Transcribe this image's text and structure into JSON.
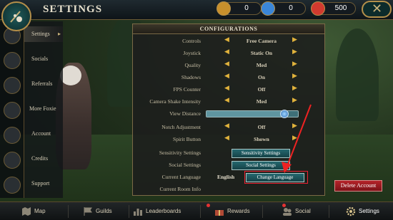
{
  "header": {
    "title": "SETTINGS"
  },
  "resources": [
    {
      "icon": "compass-coin-icon",
      "value": "0",
      "color": "#c8902c"
    },
    {
      "icon": "blue-orb-icon",
      "value": "0",
      "color": "#3a86d8"
    },
    {
      "icon": "red-gem-icon",
      "value": "500",
      "color": "#d13a2f"
    }
  ],
  "menu": {
    "items": [
      {
        "label": "Settings",
        "active": true
      },
      {
        "label": "Socials"
      },
      {
        "label": "Referrals"
      },
      {
        "label": "More Foxie"
      },
      {
        "label": "Account"
      },
      {
        "label": "Credits"
      },
      {
        "label": "Support"
      }
    ]
  },
  "config": {
    "title": "CONFIGURATIONS",
    "rows": [
      {
        "label": "Controls",
        "value": "Free Camera"
      },
      {
        "label": "Joystick",
        "value": "Static On"
      },
      {
        "label": "Quality",
        "value": "Med"
      },
      {
        "label": "Shadows",
        "value": "On"
      },
      {
        "label": "FPS Counter",
        "value": "Off"
      },
      {
        "label": "Camera Shake Intensity",
        "value": "Med"
      }
    ],
    "view_distance": {
      "label": "View Distance",
      "level": 0.85
    },
    "rows2": [
      {
        "label": "Notch Adjustment",
        "value": "Off"
      },
      {
        "label": "Spirit Button",
        "value": "Shown"
      }
    ],
    "sensitivity": {
      "label": "Sensitivity Settings",
      "button": "Sensitivity Settings"
    },
    "social": {
      "label": "Social Settings",
      "button": "Social Settings"
    },
    "language": {
      "label": "Current Language",
      "value": "English",
      "button": "Change Language"
    },
    "room": {
      "label": "Current Room Info"
    }
  },
  "delete_account": "Delete Account",
  "bottom_nav": [
    {
      "label": "Map",
      "icon": "map-icon"
    },
    {
      "label": "Guilds",
      "icon": "guild-flag-icon"
    },
    {
      "label": "Leaderboards",
      "icon": "leaderboard-icon"
    },
    {
      "label": "Rewards",
      "icon": "gift-icon"
    },
    {
      "label": "Social",
      "icon": "social-icon"
    },
    {
      "label": "Settings",
      "icon": "gear-icon",
      "active": true
    }
  ]
}
